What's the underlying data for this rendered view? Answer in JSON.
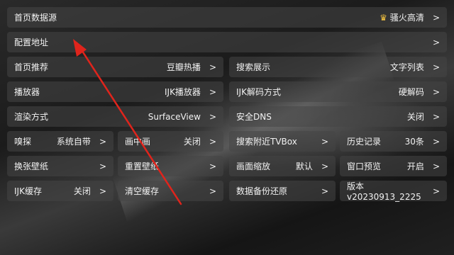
{
  "colors": {
    "annotation_arrow": "#e0241c",
    "crown": "#f3c240"
  },
  "settings": [
    {
      "id": "home-source",
      "label": "首页数据源",
      "value": "骚火高清",
      "icon": "crown-icon"
    },
    {
      "id": "config-address",
      "label": "配置地址",
      "value": ""
    },
    {
      "id": "home-recommend",
      "label": "首页推荐",
      "value": "豆瓣热播"
    },
    {
      "id": "search-display",
      "label": "搜索展示",
      "value": "文字列表"
    },
    {
      "id": "player",
      "label": "播放器",
      "value": "IJK播放器"
    },
    {
      "id": "ijk-decode",
      "label": "IJK解码方式",
      "value": "硬解码"
    },
    {
      "id": "render-mode",
      "label": "渲染方式",
      "value": "SurfaceView"
    },
    {
      "id": "secure-dns",
      "label": "安全DNS",
      "value": "关闭"
    },
    {
      "id": "sniff",
      "label": "嗅探",
      "value": "系统自带"
    },
    {
      "id": "pip",
      "label": "画中画",
      "value": "关闭"
    },
    {
      "id": "search-nearby-tvbox",
      "label": "搜索附近TVBox",
      "value": ""
    },
    {
      "id": "history",
      "label": "历史记录",
      "value": "30条"
    },
    {
      "id": "change-wallpaper",
      "label": "换张壁纸",
      "value": ""
    },
    {
      "id": "reset-wallpaper",
      "label": "重置壁纸",
      "value": ""
    },
    {
      "id": "picture-scale",
      "label": "画面缩放",
      "value": "默认"
    },
    {
      "id": "window-preview",
      "label": "窗口预览",
      "value": "开启"
    },
    {
      "id": "ijk-cache",
      "label": "IJK缓存",
      "value": "关闭"
    },
    {
      "id": "clear-cache",
      "label": "清空缓存",
      "value": ""
    },
    {
      "id": "data-backup-restore",
      "label": "数据备份还原",
      "value": ""
    },
    {
      "id": "version",
      "label": "版本v20230913_2225",
      "value": ""
    }
  ],
  "chevron": ">"
}
